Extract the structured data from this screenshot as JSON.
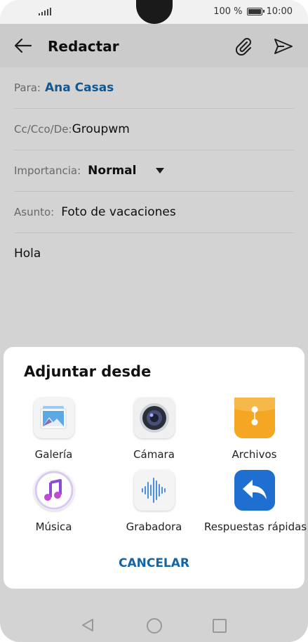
{
  "status": {
    "battery_text": "100 %",
    "time": "10:00"
  },
  "appbar": {
    "title": "Redactar"
  },
  "form": {
    "to_label": "Para:",
    "to_value": "Ana Casas",
    "cc_label": "Cc/Cco/De:",
    "cc_value": "Groupwm",
    "importance_label": "Importancia:",
    "importance_value": "Normal",
    "subject_label": "Asunto:",
    "subject_value": "Foto de vacaciones",
    "body": "Hola"
  },
  "sheet": {
    "title": "Adjuntar desde",
    "options": [
      {
        "label": "Galería",
        "icon": "gallery-icon"
      },
      {
        "label": "Cámara",
        "icon": "camera-icon"
      },
      {
        "label": "Archivos",
        "icon": "files-icon"
      },
      {
        "label": "Música",
        "icon": "music-icon"
      },
      {
        "label": "Grabadora",
        "icon": "recorder-icon"
      },
      {
        "label": "Respuestas rápidas",
        "icon": "quick-reply-icon"
      }
    ],
    "cancel_label": "CANCELAR"
  },
  "colors": {
    "accent": "#1564a6",
    "files_icon": "#f5a623",
    "quick_reply_icon": "#1f6fd1"
  }
}
